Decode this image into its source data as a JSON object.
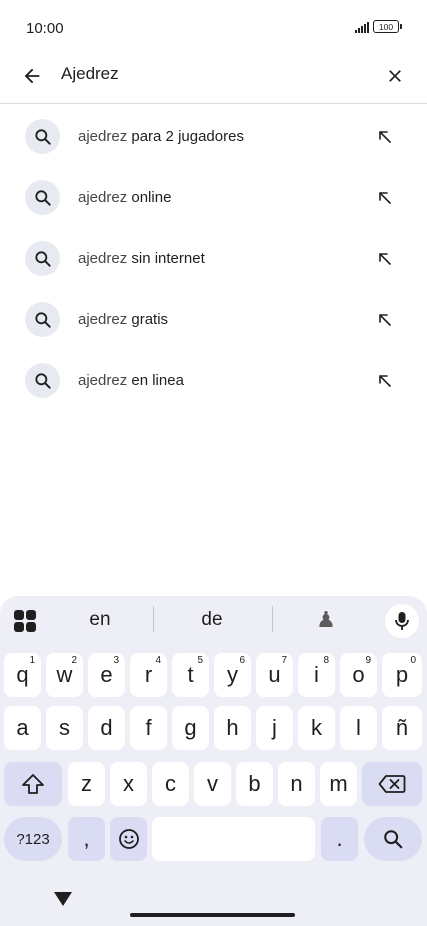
{
  "status_bar": {
    "time": "10:00",
    "battery": "100"
  },
  "search": {
    "query": "Ajedrez"
  },
  "suggestions": [
    {
      "prefix": "ajedrez",
      "suffix": " para 2 jugadores"
    },
    {
      "prefix": "ajedrez",
      "suffix": " online"
    },
    {
      "prefix": "ajedrez",
      "suffix": " sin internet"
    },
    {
      "prefix": "ajedrez",
      "suffix": " gratis"
    },
    {
      "prefix": "ajedrez",
      "suffix": " en linea"
    }
  ],
  "keyboard": {
    "suggestions": [
      "en",
      "de"
    ],
    "row1": [
      {
        "key": "q",
        "num": "1"
      },
      {
        "key": "w",
        "num": "2"
      },
      {
        "key": "e",
        "num": "3"
      },
      {
        "key": "r",
        "num": "4"
      },
      {
        "key": "t",
        "num": "5"
      },
      {
        "key": "y",
        "num": "6"
      },
      {
        "key": "u",
        "num": "7"
      },
      {
        "key": "i",
        "num": "8"
      },
      {
        "key": "o",
        "num": "9"
      },
      {
        "key": "p",
        "num": "0"
      }
    ],
    "row2": [
      "a",
      "s",
      "d",
      "f",
      "g",
      "h",
      "j",
      "k",
      "l",
      "ñ"
    ],
    "row3": [
      "z",
      "x",
      "c",
      "v",
      "b",
      "n",
      "m"
    ],
    "symbols_label": "?123",
    "comma": ",",
    "period": "."
  },
  "colors": {
    "keyboard_bg": "#edeef6",
    "accent_key": "#d9dcf3",
    "icon_bg": "#e8eaf1"
  }
}
